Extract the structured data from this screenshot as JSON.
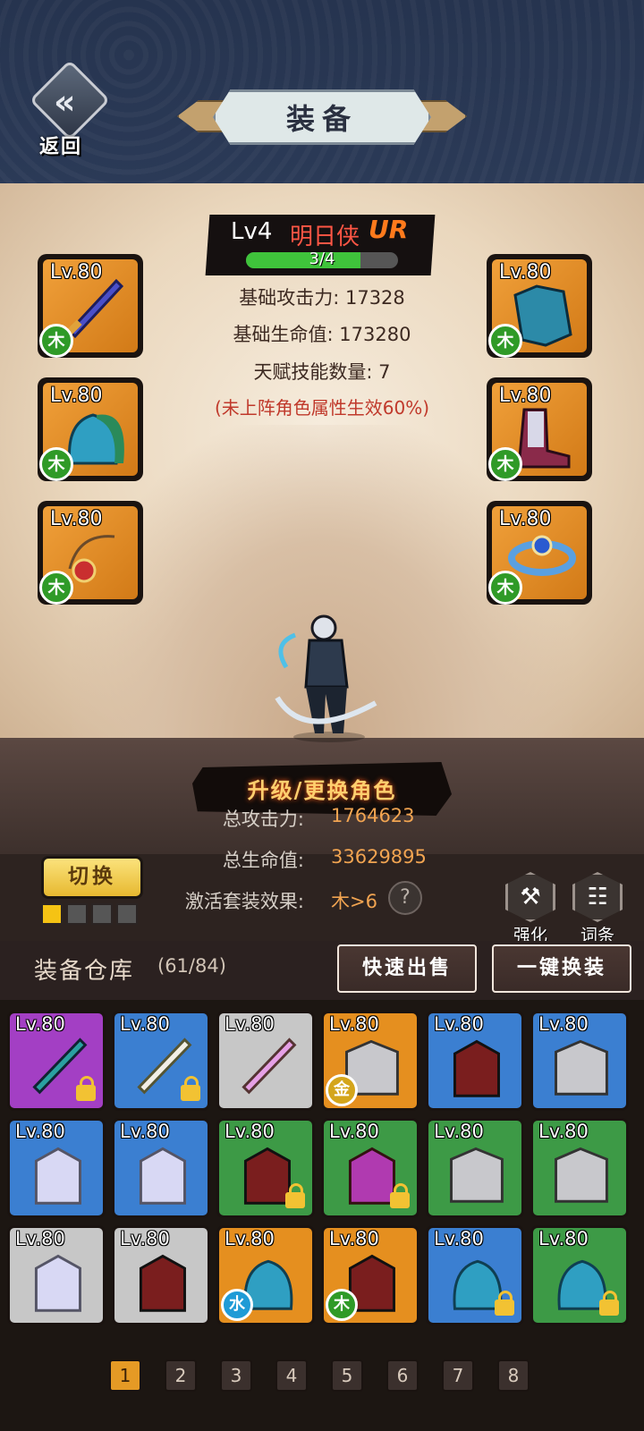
{
  "header": {
    "back_label": "返回",
    "title": "装备"
  },
  "character": {
    "level": "Lv4",
    "name": "明日侠",
    "rarity": "UR",
    "progress_text": "3/4",
    "progress": 0.75
  },
  "stats": {
    "base_attack": "基础攻击力: 17328",
    "base_hp": "基础生命值: 173280",
    "talent_count": "天赋技能数量: 7",
    "note": "(未上阵角色属性生效60%)"
  },
  "equipped": [
    {
      "level": "Lv.80",
      "element": "木",
      "item": "sword"
    },
    {
      "level": "Lv.80",
      "element": "木",
      "item": "armor"
    },
    {
      "level": "Lv.80",
      "element": "木",
      "item": "helmet"
    },
    {
      "level": "Lv.80",
      "element": "木",
      "item": "boots"
    },
    {
      "level": "Lv.80",
      "element": "木",
      "item": "necklace"
    },
    {
      "level": "Lv.80",
      "element": "木",
      "item": "ring"
    }
  ],
  "upgrade_label": "升级/更换角色",
  "totals": {
    "attack_label": "总攻击力:",
    "attack_value": "1764623",
    "hp_label": "总生命值:",
    "hp_value": "33629895",
    "set_label": "激活套装效果:",
    "set_value": "木>6",
    "help": "?"
  },
  "switch": {
    "label": "切换",
    "slots": [
      true,
      false,
      false,
      false
    ]
  },
  "tools": {
    "strengthen": "强化",
    "affix": "词条"
  },
  "storage": {
    "title": "装备仓库",
    "count": "(61/84)",
    "quick_sell": "快速出售",
    "one_click": "一键换装"
  },
  "inventory": [
    {
      "level": "Lv.80",
      "rarity": "purple",
      "locked": true,
      "badge": ""
    },
    {
      "level": "Lv.80",
      "rarity": "blue",
      "locked": true,
      "badge": ""
    },
    {
      "level": "Lv.80",
      "rarity": "gray",
      "locked": false,
      "badge": ""
    },
    {
      "level": "Lv.80",
      "rarity": "orange",
      "locked": false,
      "badge": "金"
    },
    {
      "level": "Lv.80",
      "rarity": "blue",
      "locked": false,
      "badge": ""
    },
    {
      "level": "Lv.80",
      "rarity": "blue",
      "locked": false,
      "badge": ""
    },
    {
      "level": "Lv.80",
      "rarity": "blue",
      "locked": false,
      "badge": ""
    },
    {
      "level": "Lv.80",
      "rarity": "blue",
      "locked": false,
      "badge": ""
    },
    {
      "level": "Lv.80",
      "rarity": "green",
      "locked": true,
      "badge": ""
    },
    {
      "level": "Lv.80",
      "rarity": "green",
      "locked": true,
      "badge": ""
    },
    {
      "level": "Lv.80",
      "rarity": "green",
      "locked": false,
      "badge": ""
    },
    {
      "level": "Lv.80",
      "rarity": "green",
      "locked": false,
      "badge": ""
    },
    {
      "level": "Lv.80",
      "rarity": "gray",
      "locked": false,
      "badge": ""
    },
    {
      "level": "Lv.80",
      "rarity": "gray",
      "locked": false,
      "badge": ""
    },
    {
      "level": "Lv.80",
      "rarity": "orange",
      "locked": false,
      "badge": "水"
    },
    {
      "level": "Lv.80",
      "rarity": "orange",
      "locked": false,
      "badge": "木"
    },
    {
      "level": "Lv.80",
      "rarity": "blue",
      "locked": true,
      "badge": ""
    },
    {
      "level": "Lv.80",
      "rarity": "green",
      "locked": true,
      "badge": ""
    }
  ],
  "pages": [
    "1",
    "2",
    "3",
    "4",
    "5",
    "6",
    "7",
    "8"
  ],
  "current_page": "1",
  "colors": {
    "purple": "#a33fc4",
    "blue": "#3b7fd1",
    "gray": "#c7c7c7",
    "orange": "#e58f1f",
    "green": "#3d9a46",
    "badge_metal": "#d4a51b",
    "badge_water": "#1f9bd6",
    "badge_wood": "#2f9a27"
  }
}
